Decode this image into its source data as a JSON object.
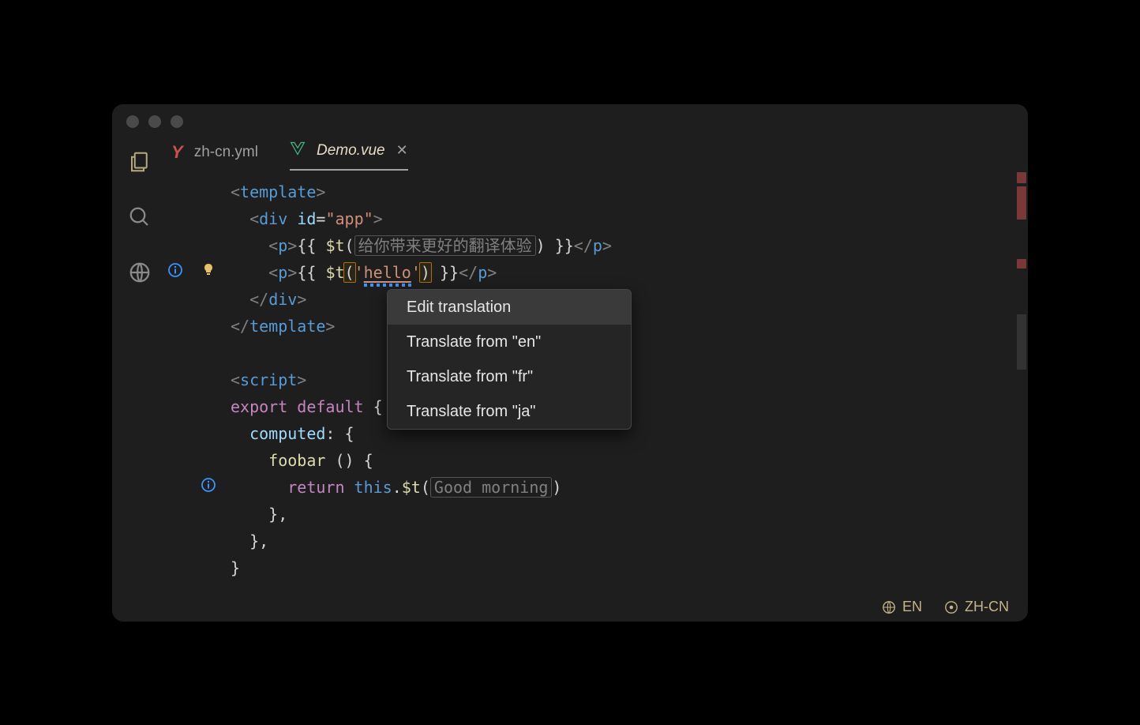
{
  "tabs": [
    {
      "label": "zh-cn.yml"
    },
    {
      "label": "Demo.vue"
    }
  ],
  "code": {
    "hint1": "给你带来更好的翻译体验",
    "helloStr": "hello",
    "hint2": "Good morning",
    "tags": {
      "template": "template",
      "div": "div",
      "p": "p",
      "script": "script"
    },
    "attr_id": "id",
    "attr_val": "\"app\"",
    "fn": "$t",
    "export": "export",
    "default": "default",
    "computed": "computed",
    "foobar": "foobar",
    "return": "return",
    "this": "this"
  },
  "menu": {
    "edit": "Edit translation",
    "fromEn": "Translate from \"en\"",
    "fromFr": "Translate from \"fr\"",
    "fromJa": "Translate from \"ja\""
  },
  "status": {
    "lang1": "EN",
    "lang2": "ZH-CN"
  }
}
